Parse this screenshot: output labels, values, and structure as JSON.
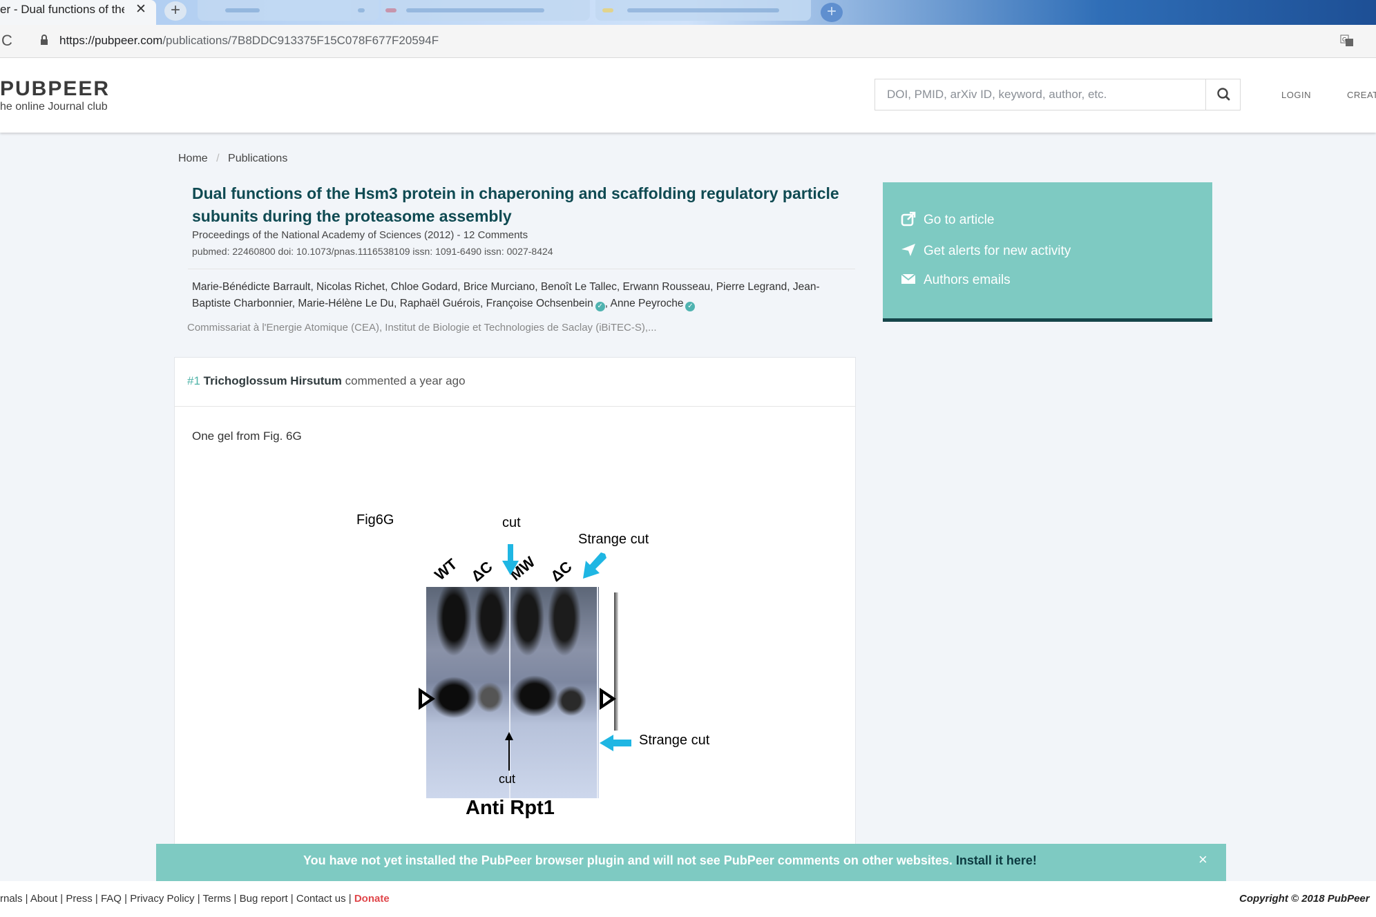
{
  "browser": {
    "active_tab_title": "er - Dual functions of the H",
    "close_glyph": "✕",
    "new_tab_glyph": "+",
    "url_host": "https://pubpeer.com",
    "url_path": "/publications/7B8DDC913375F15C078F677F20594F",
    "reload_glyph": "C"
  },
  "site": {
    "logo": "PUBPEER",
    "tagline": "he online Journal club",
    "search_placeholder": "DOI, PMID, arXiv ID, keyword, author, etc.",
    "login": "LOGIN",
    "create": "CREAT"
  },
  "breadcrumb": {
    "home": "Home",
    "separator": "/",
    "current": "Publications"
  },
  "publication": {
    "title": "Dual functions of the Hsm3 protein in chaperoning and scaffolding regulatory particle subunits during the proteasome assembly",
    "journal_line": "Proceedings of the National Academy of Sciences (2012) - 12 Comments",
    "ids_line": "pubmed: 22460800  doi: 10.1073/pnas.1116538109  issn: 1091-6490  issn: 0027-8424",
    "authors_main": "Marie-Bénédicte Barrault, Nicolas Richet, Chloe Godard, Brice Murciano, Benoît Le Tallec, Erwann Rousseau, Pierre Legrand, Jean-Baptiste Charbonnier, Marie-Hélène Le Du, Raphaël Guérois, Françoise Ochsenbein",
    "authors_last": "Anne Peyroche",
    "affiliation": "Commissariat à l'Energie Atomique (CEA), Institut de Biologie et Technologies de Saclay (iBiTEC-S),..."
  },
  "sidebar": {
    "go_to_article": "Go to article",
    "alerts": "Get alerts for new activity",
    "emails": "Authors emails"
  },
  "comment": {
    "number": "#1",
    "author": "Trichoglossum Hirsutum",
    "action": "commented a year ago",
    "body": "One gel from Fig. 6G"
  },
  "figure": {
    "label": "Fig6G",
    "cut_top": "cut",
    "strange_cut_top": "Strange cut",
    "strange_cut_right": "Strange cut",
    "cut_bottom": "cut",
    "caption": "Anti Rpt1",
    "lanes": [
      "WT",
      "ΔC",
      "MW",
      "ΔC"
    ]
  },
  "banner": {
    "text": "You have not yet installed the PubPeer browser plugin and will not see PubPeer comments on other websites.",
    "link": "Install it here!",
    "close": "×"
  },
  "footer": {
    "links": [
      "rnals",
      "About",
      "Press",
      "FAQ",
      "Privacy Policy",
      "Terms",
      "Bug report",
      "Contact us"
    ],
    "donate": "Donate",
    "copyright": "Copyright © 2018 PubPeer"
  },
  "colors": {
    "accent_teal": "#7ecac2",
    "title_color": "#0f4a52",
    "donate_red": "#e0464a",
    "arrow_cyan": "#1fb6e3"
  }
}
